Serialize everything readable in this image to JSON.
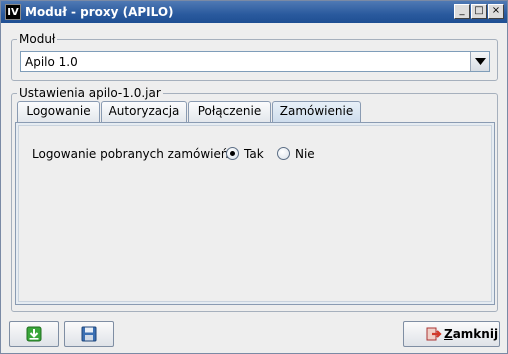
{
  "window": {
    "app_icon": "IV",
    "title": "Moduł - proxy (APILO)",
    "controls": {
      "minimize": "_",
      "maximize": "□",
      "close": "×"
    }
  },
  "module_group": {
    "label": "Moduł",
    "selected": "Apilo 1.0"
  },
  "settings_group": {
    "label": "Ustawienia apilo-1.0.jar"
  },
  "tabs": [
    {
      "label": "Logowanie",
      "active": false
    },
    {
      "label": "Autoryzacja",
      "active": false
    },
    {
      "label": "Połączenie",
      "active": false
    },
    {
      "label": "Zamówienie",
      "active": true
    }
  ],
  "order_panel": {
    "field_label": "Logowanie pobranych zamówień",
    "options": [
      {
        "label": "Tak",
        "checked": true
      },
      {
        "label": "Nie",
        "checked": false
      }
    ]
  },
  "footer": {
    "import_icon": "download-arrow-icon",
    "save_icon": "floppy-disk-icon",
    "close_label_first": "Z",
    "close_label_rest": "amknij",
    "close_icon": "exit-door-icon"
  },
  "colors": {
    "titlebar": "#2a5a9e",
    "window_bg": "#eeeeee",
    "accent_green": "#3aa63a",
    "accent_red": "#d23a2a"
  }
}
